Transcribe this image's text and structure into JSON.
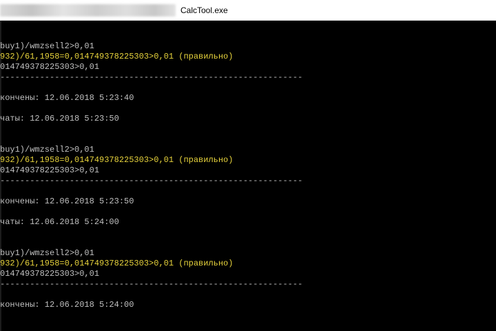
{
  "window": {
    "title": "CalcTool.exe"
  },
  "console": {
    "lines": [
      {
        "text": "buy1)/wmzsell2>0,01",
        "color": "gray"
      },
      {
        "text": "932)/61,1958=0,014749378225303>0,01 (правильно)",
        "color": "yellow"
      },
      {
        "text": "014749378225303>0,01",
        "color": "gray"
      },
      {
        "text": "-------------------------------------------------------------",
        "color": "gray"
      },
      {
        "text": "кончены: 12.06.2018 5:23:40",
        "color": "gray"
      },
      {
        "text": "чаты: 12.06.2018 5:23:50",
        "color": "gray"
      },
      {
        "text": "buy1)/wmzsell2>0,01",
        "color": "gray"
      },
      {
        "text": "932)/61,1958=0,014749378225303>0,01 (правильно)",
        "color": "yellow"
      },
      {
        "text": "014749378225303>0,01",
        "color": "gray"
      },
      {
        "text": "-------------------------------------------------------------",
        "color": "gray"
      },
      {
        "text": "кончены: 12.06.2018 5:23:50",
        "color": "gray"
      },
      {
        "text": "чаты: 12.06.2018 5:24:00",
        "color": "gray"
      },
      {
        "text": "buy1)/wmzsell2>0,01",
        "color": "gray"
      },
      {
        "text": "932)/61,1958=0,014749378225303>0,01 (правильно)",
        "color": "yellow"
      },
      {
        "text": "014749378225303>0,01",
        "color": "gray"
      },
      {
        "text": "-------------------------------------------------------------",
        "color": "gray"
      },
      {
        "text": "кончены: 12.06.2018 5:24:00",
        "color": "gray"
      }
    ]
  },
  "colors": {
    "background": "#000000",
    "text_gray": "#c0c0c0",
    "text_yellow": "#e6d23c",
    "titlebar": "#ffffff"
  }
}
